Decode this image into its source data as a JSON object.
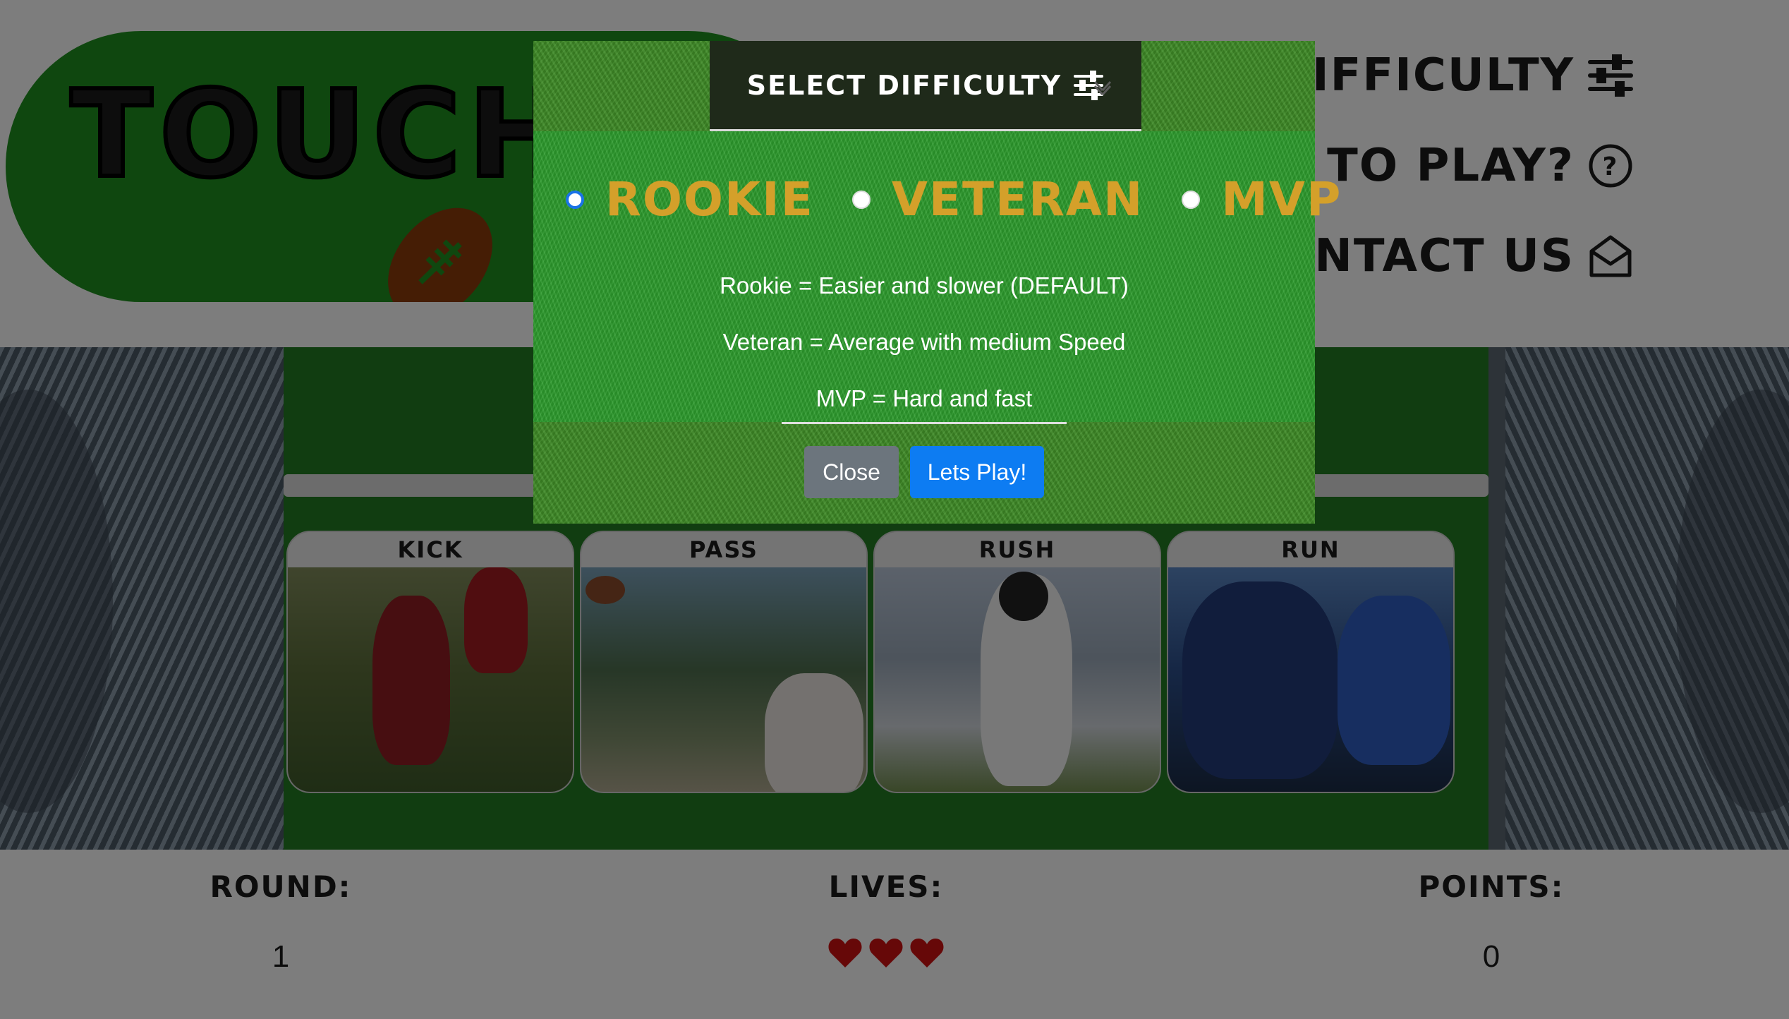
{
  "header": {
    "logo_text": "TOUCHDOWN",
    "nav": {
      "difficulty": "DIFFICULTY",
      "how_to_play": "HOW TO PLAY?",
      "contact": "CONTACT US"
    }
  },
  "plays": [
    {
      "label": "KICK"
    },
    {
      "label": "PASS"
    },
    {
      "label": "RUSH"
    },
    {
      "label": "RUN"
    }
  ],
  "scoreboard": {
    "round_label": "ROUND:",
    "round_value": "1",
    "lives_label": "LIVES:",
    "lives_count": 3,
    "points_label": "POINTS:",
    "points_value": "0"
  },
  "modal": {
    "title": "SELECT DIFFICULTY",
    "options": [
      {
        "label": "ROOKIE",
        "checked": true
      },
      {
        "label": "VETERAN",
        "checked": false
      },
      {
        "label": "MVP",
        "checked": false
      }
    ],
    "descriptions": [
      "Rookie = Easier and slower (DEFAULT)",
      "Veteran = Average with medium Speed",
      "MVP = Hard and fast"
    ],
    "close_label": "Close",
    "play_label": "Lets Play!"
  },
  "colors": {
    "field_green": "#237a23",
    "gold": "#d4a02a",
    "primary_blue": "#0d7cf2",
    "secondary_grey": "#6c757d",
    "heart_red": "#cc1010"
  },
  "icons": {
    "difficulty": "sliders-icon",
    "how_to_play": "question-circle-icon",
    "contact": "envelope-open-icon",
    "logo": "football-icon",
    "lives": "heart-icon"
  }
}
